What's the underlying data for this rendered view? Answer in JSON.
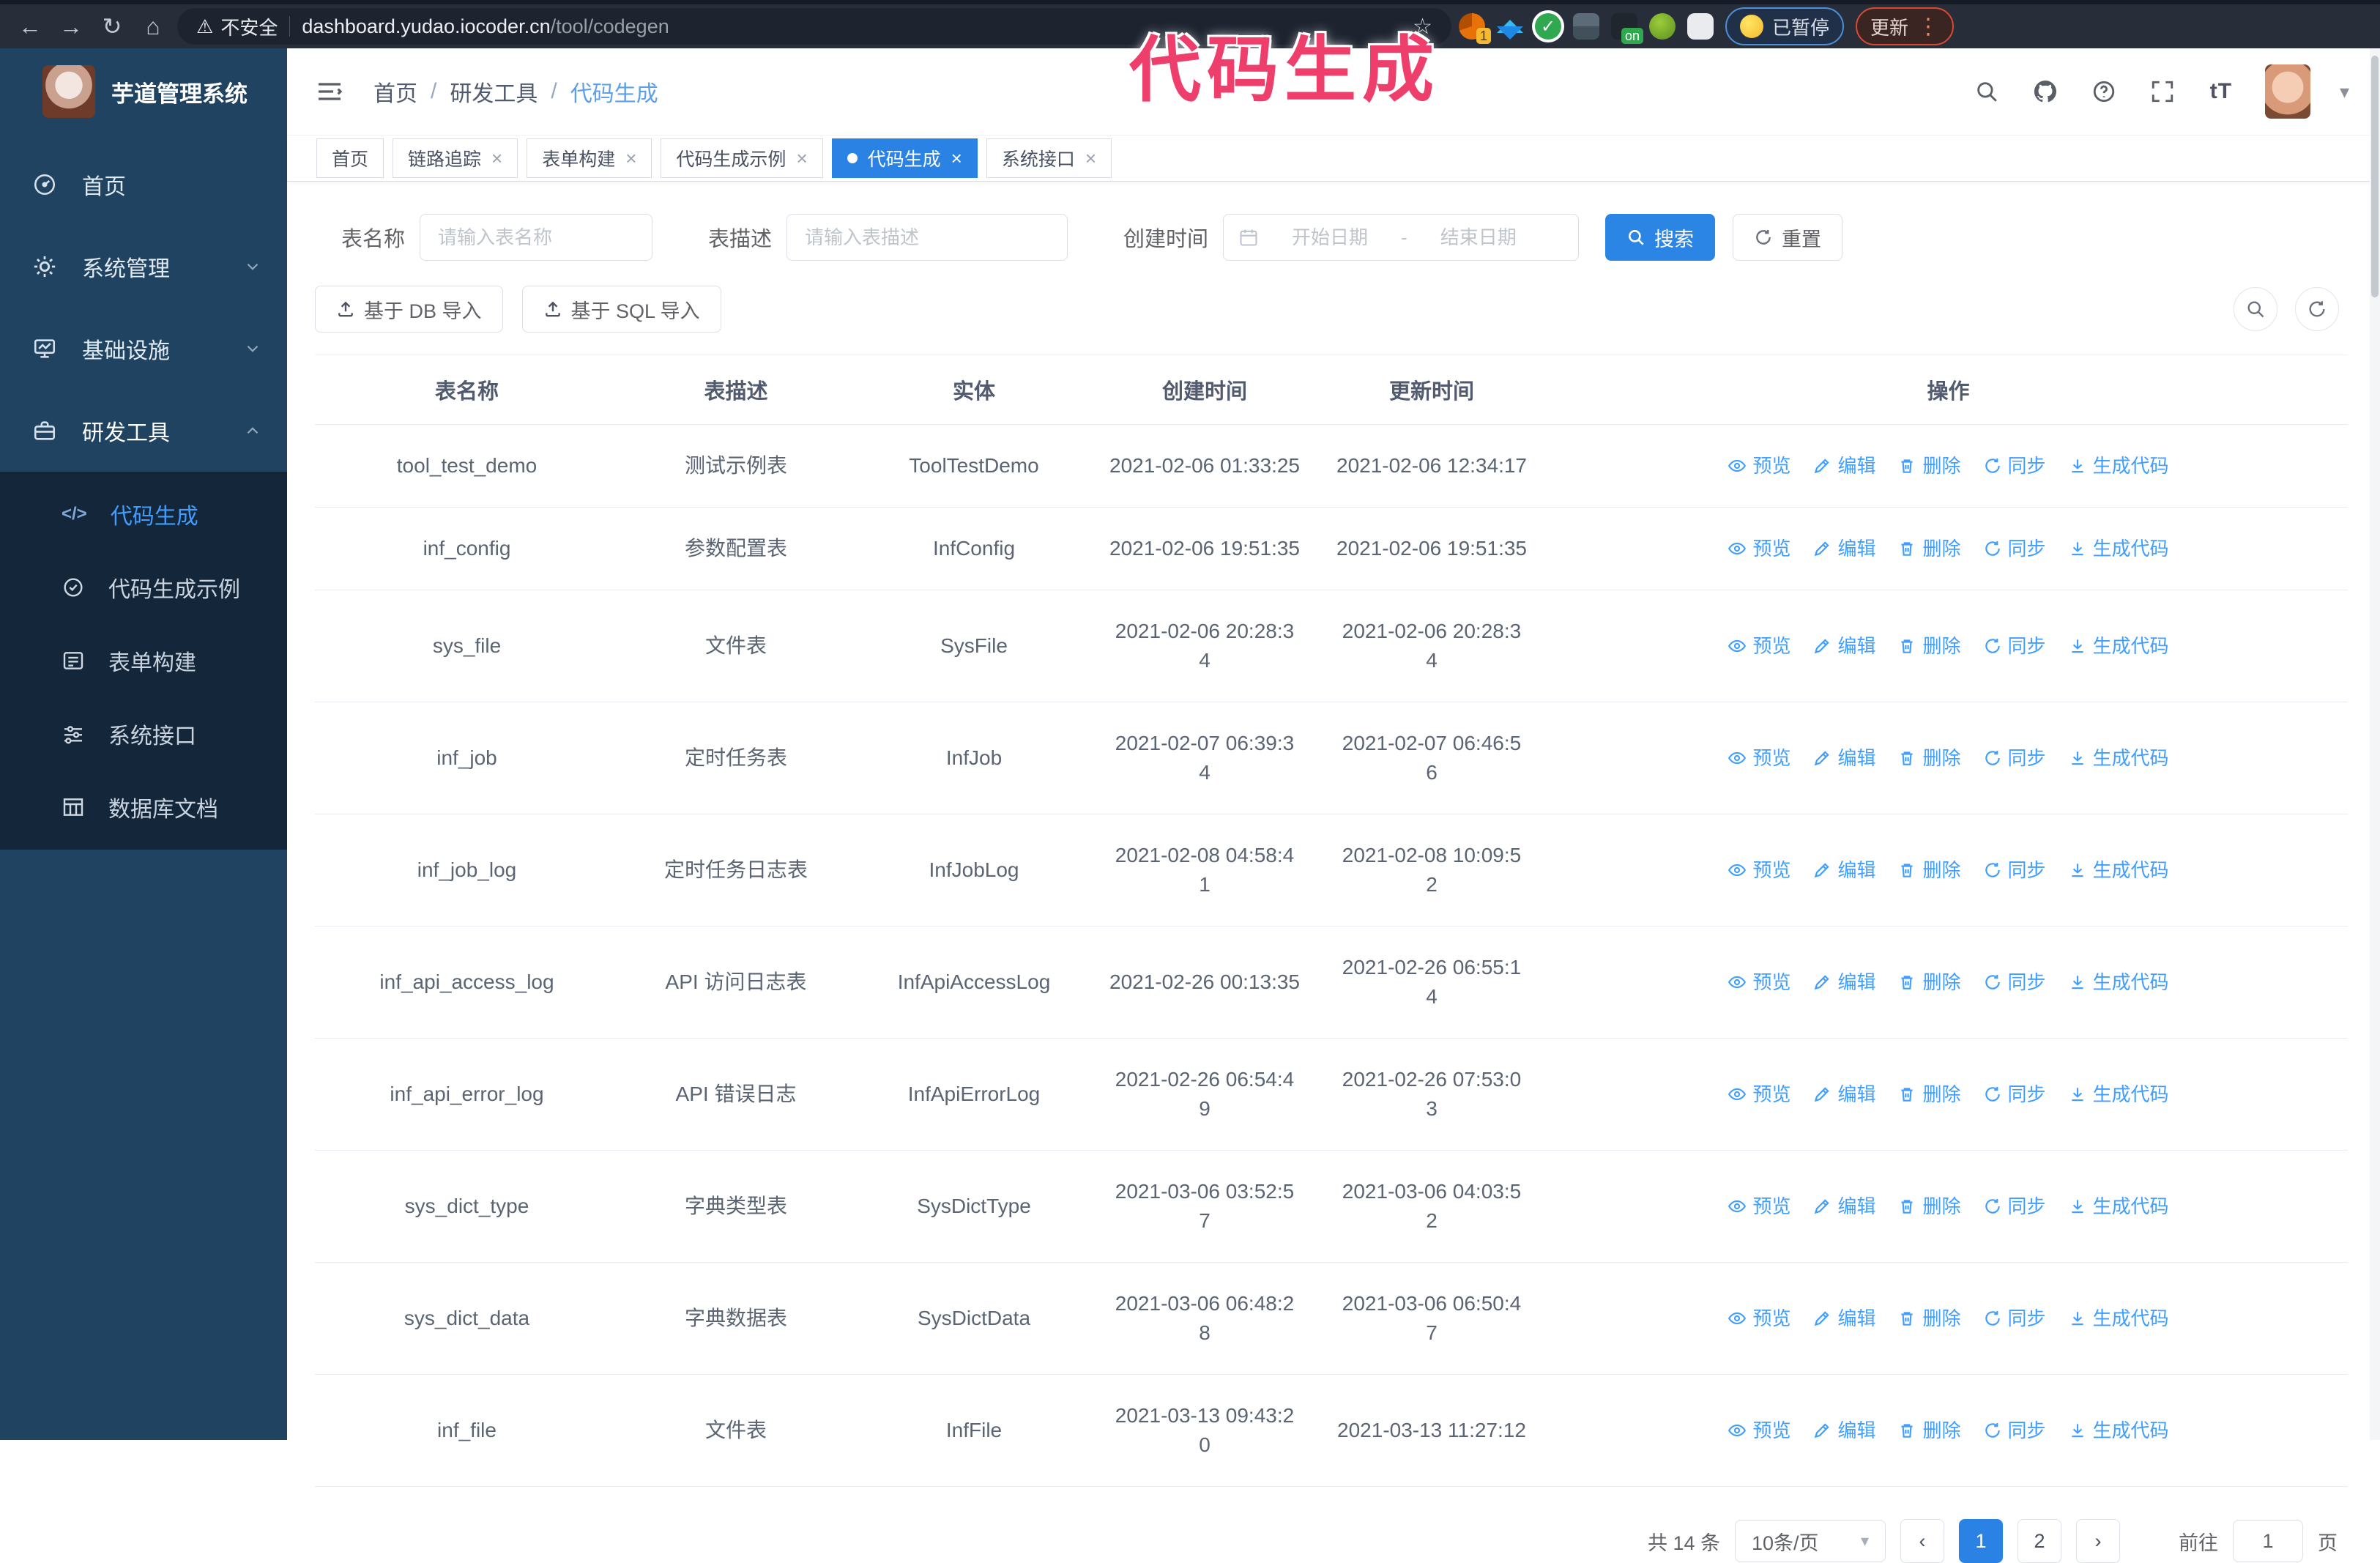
{
  "browser": {
    "security_label": "不安全",
    "url_host": "dashboard.yudao.iocoder.cn",
    "url_path": "/tool/codegen",
    "paused_chip": "已暂停",
    "update_chip": "更新",
    "ext_badge_one": "1",
    "ext_badge_on": "on"
  },
  "icons": {
    "back": "←",
    "forward": "→",
    "reload": "↻",
    "home": "⌂",
    "warning": "⚠",
    "star": "☆",
    "dots": "⋮",
    "caret_down": "▾",
    "check": "✓",
    "font_size": "tT",
    "code": "</>",
    "pager_prev": "‹",
    "pager_next": "›",
    "select_caret": "▾"
  },
  "overlay": {
    "title": "代码生成"
  },
  "app": {
    "title": "芋道管理系统"
  },
  "sidebar": {
    "items": [
      {
        "label": "首页",
        "icon": "dashboard-icon"
      },
      {
        "label": "系统管理",
        "icon": "gear-icon"
      },
      {
        "label": "基础设施",
        "icon": "monitor-icon"
      },
      {
        "label": "研发工具",
        "icon": "toolbox-icon"
      }
    ],
    "submenu": [
      {
        "label": "代码生成",
        "icon": "code-icon",
        "active": true
      },
      {
        "label": "代码生成示例",
        "icon": "badge-check-icon"
      },
      {
        "label": "表单构建",
        "icon": "form-icon"
      },
      {
        "label": "系统接口",
        "icon": "sliders-icon"
      },
      {
        "label": "数据库文档",
        "icon": "db-table-icon"
      }
    ]
  },
  "breadcrumb": {
    "separator": "/",
    "items": [
      "首页",
      "研发工具",
      "代码生成"
    ]
  },
  "tabs": [
    {
      "label": "首页"
    },
    {
      "label": "链路追踪",
      "closable": true
    },
    {
      "label": "表单构建",
      "closable": true
    },
    {
      "label": "代码生成示例",
      "closable": true
    },
    {
      "label": "代码生成",
      "closable": true,
      "active": true
    },
    {
      "label": "系统接口",
      "closable": true
    }
  ],
  "filters": {
    "name_label": "表名称",
    "name_placeholder": "请输入表名称",
    "desc_label": "表描述",
    "desc_placeholder": "请输入表描述",
    "date_label": "创建时间",
    "date_start_placeholder": "开始日期",
    "date_separator": "-",
    "date_end_placeholder": "结束日期",
    "search_label": "搜索",
    "reset_label": "重置"
  },
  "toolbar": {
    "import_db_label": "基于 DB 导入",
    "import_sql_label": "基于 SQL 导入"
  },
  "table": {
    "columns": [
      "表名称",
      "表描述",
      "实体",
      "创建时间",
      "更新时间",
      "操作"
    ],
    "actions": [
      {
        "label": "预览",
        "icon": "eye-icon"
      },
      {
        "label": "编辑",
        "icon": "edit-icon"
      },
      {
        "label": "删除",
        "icon": "trash-icon"
      },
      {
        "label": "同步",
        "icon": "sync-icon"
      },
      {
        "label": "生成代码",
        "icon": "download-icon"
      }
    ],
    "rows": [
      {
        "name": "tool_test_demo",
        "desc": "测试示例表",
        "entity": "ToolTestDemo",
        "created": "2021-02-06 01:33:25",
        "updated": "2021-02-06 12:34:17"
      },
      {
        "name": "inf_config",
        "desc": "参数配置表",
        "entity": "InfConfig",
        "created": "2021-02-06 19:51:35",
        "updated": "2021-02-06 19:51:35"
      },
      {
        "name": "sys_file",
        "desc": "文件表",
        "entity": "SysFile",
        "created": "2021-02-06 20:28:3\n4",
        "updated": "2021-02-06 20:28:3\n4"
      },
      {
        "name": "inf_job",
        "desc": "定时任务表",
        "entity": "InfJob",
        "created": "2021-02-07 06:39:3\n4",
        "updated": "2021-02-07 06:46:5\n6"
      },
      {
        "name": "inf_job_log",
        "desc": "定时任务日志表",
        "entity": "InfJobLog",
        "created": "2021-02-08 04:58:4\n1",
        "updated": "2021-02-08 10:09:5\n2"
      },
      {
        "name": "inf_api_access_log",
        "desc": "API 访问日志表",
        "entity": "InfApiAccessLog",
        "created": "2021-02-26 00:13:35",
        "updated": "2021-02-26 06:55:1\n4"
      },
      {
        "name": "inf_api_error_log",
        "desc": "API 错误日志",
        "entity": "InfApiErrorLog",
        "created": "2021-02-26 06:54:4\n9",
        "updated": "2021-02-26 07:53:0\n3"
      },
      {
        "name": "sys_dict_type",
        "desc": "字典类型表",
        "entity": "SysDictType",
        "created": "2021-03-06 03:52:5\n7",
        "updated": "2021-03-06 04:03:5\n2"
      },
      {
        "name": "sys_dict_data",
        "desc": "字典数据表",
        "entity": "SysDictData",
        "created": "2021-03-06 06:48:2\n8",
        "updated": "2021-03-06 06:50:4\n7"
      },
      {
        "name": "inf_file",
        "desc": "文件表",
        "entity": "InfFile",
        "created": "2021-03-13 09:43:2\n0",
        "updated": "2021-03-13 11:27:12"
      }
    ]
  },
  "pagination": {
    "total_label": "共 14 条",
    "page_size_label": "10条/页",
    "pages": [
      "1",
      "2"
    ],
    "active_page": "1",
    "goto_label": "前往",
    "goto_value": "1",
    "page_unit": "页"
  }
}
